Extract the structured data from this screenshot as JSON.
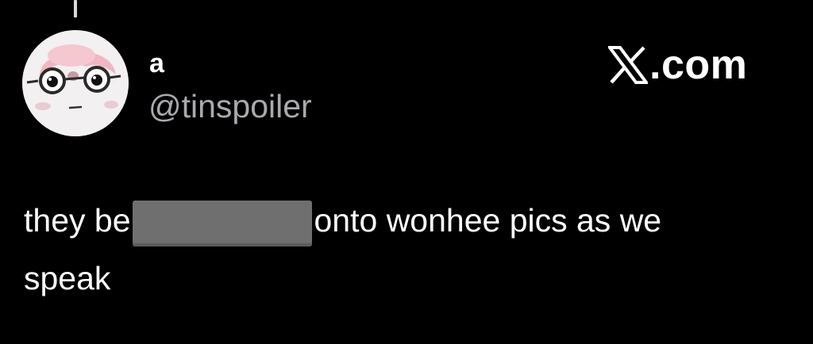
{
  "post": {
    "display_name": "a",
    "handle": "@tinspoiler",
    "avatar_icon": "cartoon-face-with-glasses-avatar",
    "text_part1": "they be",
    "text_part2": "onto wonhee pics as we",
    "text_line2": "speak"
  },
  "watermark": {
    "logo_icon": "x-logo-icon",
    "text": ".com"
  },
  "colors": {
    "background": "#000000",
    "text": "#ffffff",
    "handle": "#a8aaad",
    "redaction": "#6f6f70"
  }
}
